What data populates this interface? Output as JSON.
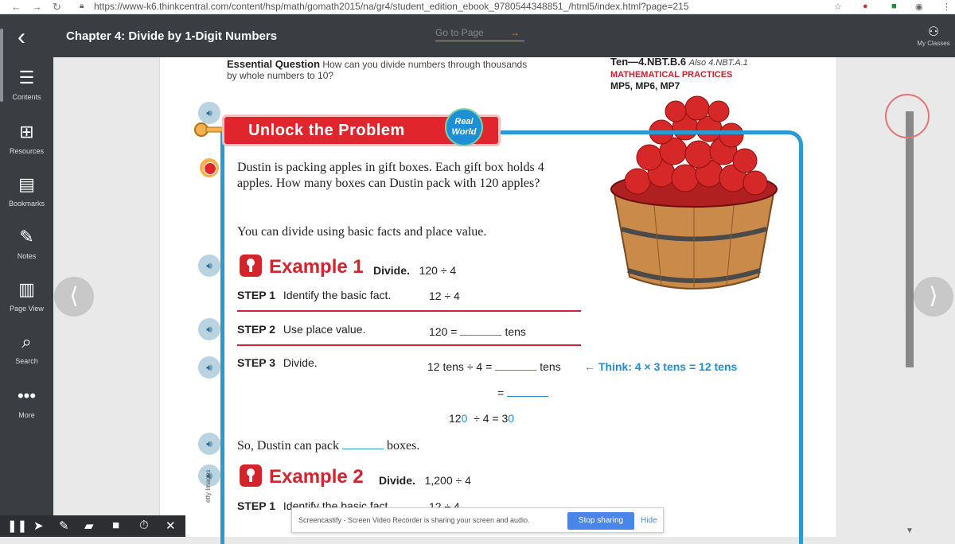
{
  "browser": {
    "url": "https://www-k6.thinkcentral.com/content/hsp/math/gomath2015/na/gr4/student_edition_ebook_9780544348851_/html5/index.html?page=215"
  },
  "header": {
    "title": "Chapter 4: Divide by 1-Digit Numbers",
    "goto_label": "Go to Page",
    "goto_arrow": "→",
    "my_classes": "My Classes"
  },
  "sidebar": {
    "items": [
      {
        "label": "Contents",
        "icon": "list-icon"
      },
      {
        "label": "Resources",
        "icon": "folder-plus-icon"
      },
      {
        "label": "Bookmarks",
        "icon": "bookmark-icon"
      },
      {
        "label": "Notes",
        "icon": "pencil-icon"
      },
      {
        "label": "Page View",
        "icon": "page-view-icon"
      },
      {
        "label": "Search",
        "icon": "search-icon"
      },
      {
        "label": "More",
        "icon": "more-icon"
      }
    ]
  },
  "page": {
    "essential_label": "Essential Question",
    "essential_text": "How can you divide numbers through thousands by whole numbers to 10?",
    "standard": "Ten—4.NBT.B.6",
    "standard_also": "Also 4.NBT.A.1",
    "mp_title": "MATHEMATICAL PRACTICES",
    "mp_list": "MP5, MP6, MP7",
    "banner": "Unlock the Problem",
    "real_world_1": "Real",
    "real_world_2": "World",
    "problem": "Dustin is packing apples in gift boxes. Each gift box holds 4 apples. How many boxes can Dustin pack with 120 apples?",
    "hint": "You can divide using basic facts and place value.",
    "example1": {
      "title": "Example 1",
      "divide": "Divide.",
      "expr": "120 ÷ 4"
    },
    "step1": {
      "label": "STEP 1",
      "text": "Identify the basic fact.",
      "math": "12 ÷ 4"
    },
    "step2": {
      "label": "STEP 2",
      "text": "Use place value.",
      "math_left": "120 =",
      "math_right": "tens"
    },
    "step3": {
      "label": "STEP 3",
      "text": "Divide.",
      "math_left": "12 tens ÷ 4 =",
      "math_right": "tens",
      "eq": "="
    },
    "think": "Think: 4 × 3 tens = 12 tens",
    "result_a": "12",
    "result_b": "0",
    "result_c": "÷ 4 = 3",
    "result_d": "0",
    "conclusion_a": "So, Dustin can pack",
    "conclusion_b": "boxes.",
    "example2": {
      "title": "Example 2",
      "divide": "Divide.",
      "expr": "1,200 ÷ 4"
    },
    "step1b": {
      "label": "STEP 1",
      "text": "Identify the basic fact.",
      "math": "12 ÷ 4"
    },
    "credit": "etty Images"
  },
  "toast": {
    "message": "Screencastify - Screen Video Recorder is sharing your screen and audio.",
    "stop": "Stop sharing",
    "hide": "Hide"
  },
  "colors": {
    "accent_red": "#d4232b",
    "accent_blue": "#2a9ad6",
    "header_bg": "#3a3d42"
  }
}
